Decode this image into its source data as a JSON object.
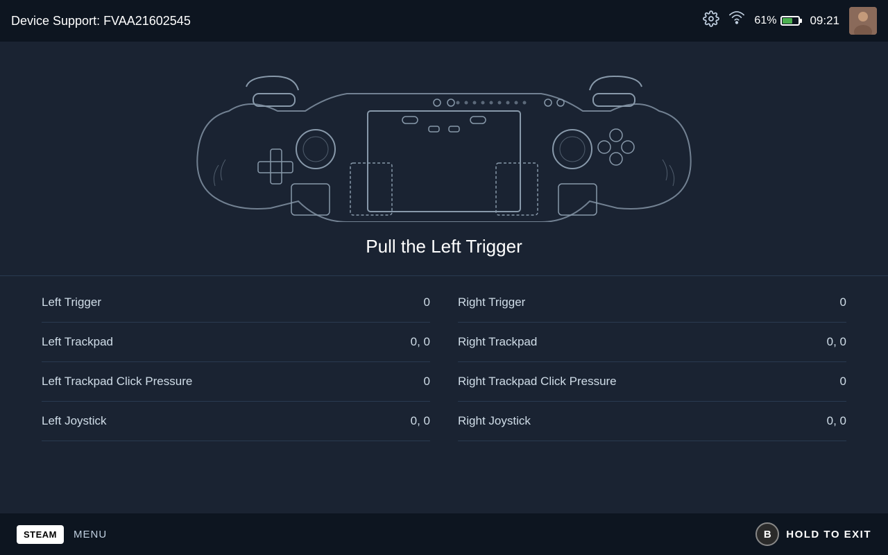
{
  "header": {
    "title": "Device Support: FVAA21602545",
    "battery_percent": "61%",
    "time": "09:21"
  },
  "controller": {
    "instruction": "Pull the Left Trigger"
  },
  "controls": {
    "left": [
      {
        "label": "Left Trigger",
        "value": "0"
      },
      {
        "label": "Left Trackpad",
        "value": "0, 0"
      },
      {
        "label": "Left Trackpad Click Pressure",
        "value": "0"
      },
      {
        "label": "Left Joystick",
        "value": "0, 0"
      }
    ],
    "right": [
      {
        "label": "Right Trigger",
        "value": "0"
      },
      {
        "label": "Right Trackpad",
        "value": "0, 0"
      },
      {
        "label": "Right Trackpad Click Pressure",
        "value": "0"
      },
      {
        "label": "Right Joystick",
        "value": "0, 0"
      }
    ]
  },
  "footer": {
    "steam_label": "STEAM",
    "menu_label": "MENU",
    "hold_exit_label": "HOLD TO EXIT",
    "b_button_label": "B"
  }
}
